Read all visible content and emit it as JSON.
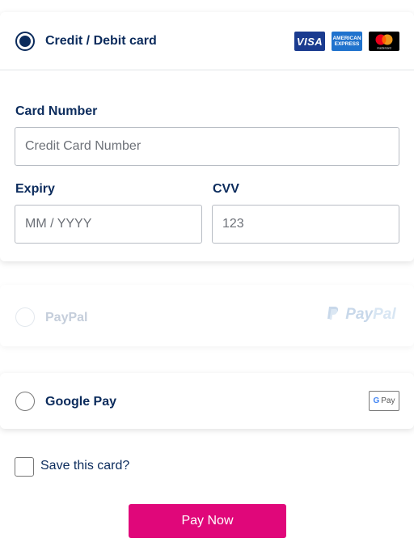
{
  "payment_options": {
    "credit_card": {
      "label": "Credit / Debit card",
      "selected": true
    },
    "paypal": {
      "label": "PayPal",
      "logo_text_1": "Pay",
      "logo_text_2": "Pal",
      "disabled": true
    },
    "google_pay": {
      "label": "Google Pay",
      "badge_text": "Pay"
    }
  },
  "card_logos": {
    "visa": "VISA",
    "amex_line1": "AMERICAN",
    "amex_line2": "EXPRESS",
    "mastercard_caption": "mastercard"
  },
  "form": {
    "card_number_label": "Card Number",
    "card_number_placeholder": "Credit Card Number",
    "expiry_label": "Expiry",
    "expiry_placeholder": "MM / YYYY",
    "cvv_label": "CVV",
    "cvv_placeholder": "123"
  },
  "save_card_label": "Save this card?",
  "pay_button_label": "Pay Now",
  "colors": {
    "primary_text": "#0b2b5c",
    "accent_button": "#e0077a",
    "visa_blue": "#1a3b8f",
    "amex_blue": "#1f72cd"
  }
}
